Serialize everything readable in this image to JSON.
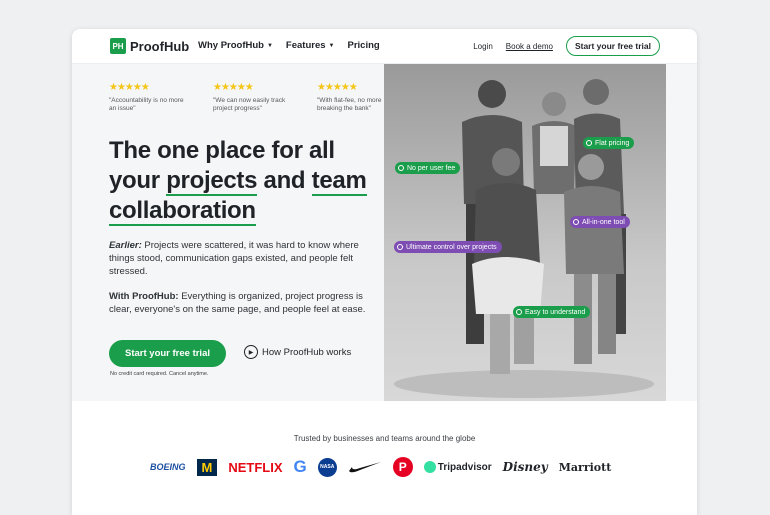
{
  "nav": {
    "logo_mark": "PH",
    "logo_text": "ProofHub",
    "menu": [
      {
        "label": "Why ProofHub",
        "has_caret": true
      },
      {
        "label": "Features",
        "has_caret": true
      },
      {
        "label": "Pricing",
        "has_caret": false
      }
    ],
    "login": "Login",
    "book_demo": "Book a demo",
    "trial_button": "Start your free trial"
  },
  "reviews": [
    {
      "stars": "★★★★★",
      "quote": "\"Accountability is no more an issue\""
    },
    {
      "stars": "★★★★★",
      "quote": "\"We can now easily track project progress\""
    },
    {
      "stars": "★★★★★",
      "quote": "\"With flat-fee, no more breaking the bank\""
    }
  ],
  "hero": {
    "h1_part1": "The one place for all your ",
    "h1_u1": "projects",
    "h1_part2": " and ",
    "h1_u2": "team collaboration",
    "earlier_label": "Earlier:",
    "earlier_text": " Projects were scattered, it was hard to know where things stood, communication gaps existed, and people felt stressed.",
    "with_label": "With ProofHub:",
    "with_text": " Everything is organized, project progress is clear, everyone's on the same page, and people feel at ease.",
    "cta": "Start your free trial",
    "how": "How ProofHub works",
    "note": "No credit card required. Cancel anytime."
  },
  "photo_tags": [
    {
      "label": "No per user fee",
      "color": "green"
    },
    {
      "label": "Flat pricing",
      "color": "green"
    },
    {
      "label": "All-in-one tool",
      "color": "purple"
    },
    {
      "label": "Ultimate control over projects",
      "color": "purple"
    },
    {
      "label": "Easy to understand",
      "color": "green"
    }
  ],
  "trusted": {
    "title": "Trusted by businesses and teams around the globe",
    "logos": [
      "BOEING",
      "M",
      "NETFLIX",
      "G",
      "NASA",
      "nike-swoosh",
      "pinterest",
      "Tripadvisor",
      "Disney",
      "Marriott"
    ]
  },
  "colors": {
    "brand_green": "#1b9e4b",
    "tag_purple": "#7d4db3",
    "stars": "#f5c518"
  }
}
